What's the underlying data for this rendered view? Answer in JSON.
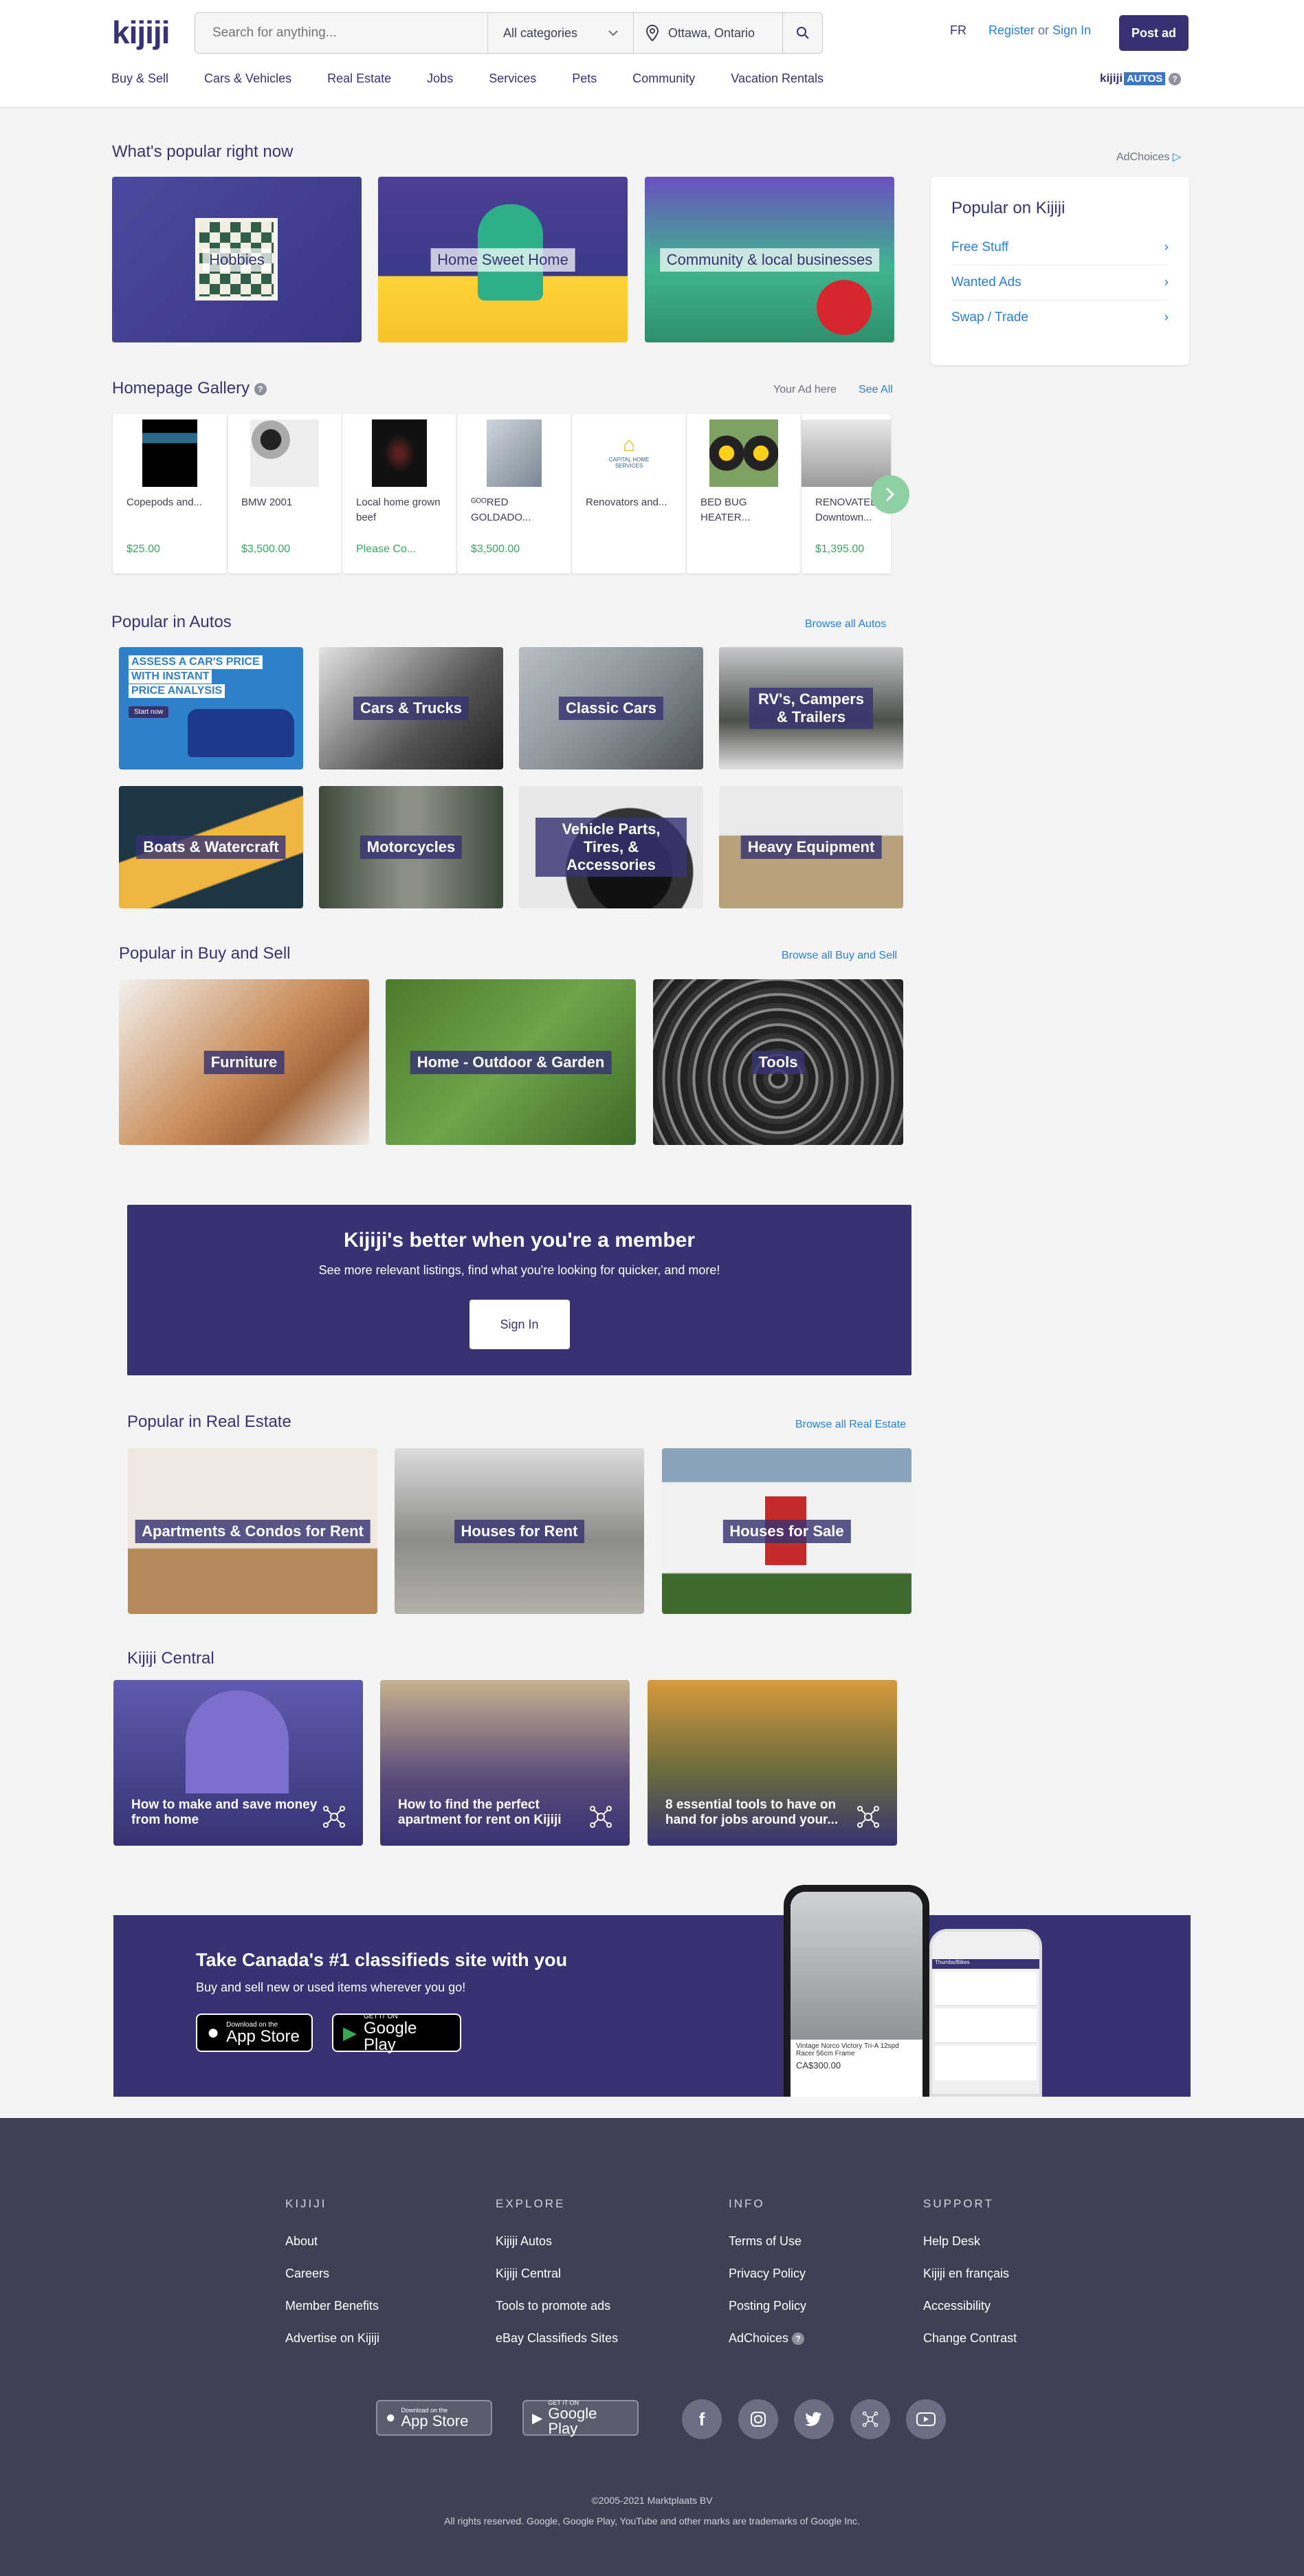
{
  "header": {
    "logo": "kijiji",
    "search_placeholder": "Search for anything...",
    "category": "All categories",
    "location": "Ottawa, Ontario",
    "lang": "FR",
    "register": "Register",
    "or": "or",
    "sign_in": "Sign In",
    "post_ad": "Post ad",
    "autos_logo_a": "kijiji",
    "autos_logo_b": "AUTOS"
  },
  "nav": [
    "Buy & Sell",
    "Cars & Vehicles",
    "Real Estate",
    "Jobs",
    "Services",
    "Pets",
    "Community",
    "Vacation Rentals"
  ],
  "popular_now": {
    "title": "What's popular right now",
    "tiles": [
      "Hobbies",
      "Home Sweet Home",
      "Community & local businesses"
    ]
  },
  "adchoices": "AdChoices",
  "popular_kijiji": {
    "title": "Popular on Kijiji",
    "items": [
      "Free Stuff",
      "Wanted Ads",
      "Swap / Trade"
    ]
  },
  "gallery": {
    "title": "Homepage Gallery",
    "your_ad": "Your Ad here",
    "see_all": "See All",
    "items": [
      {
        "title": "Copepods and...",
        "price": "$25.00"
      },
      {
        "title": "BMW 2001",
        "price": "$3,500.00"
      },
      {
        "title": "Local home grown beef",
        "price": "Please Co..."
      },
      {
        "title": "ᴳᴼᴼRED GOLDADO...",
        "price": "$3,500.00"
      },
      {
        "title": "Renovators and...",
        "price": ""
      },
      {
        "title": "BED BUG HEATER...",
        "price": ""
      },
      {
        "title": "RENOVATED Downtown...",
        "price": "$1,395.00"
      }
    ],
    "capital_text": "CAPITAL HOME SERVICES"
  },
  "autos": {
    "title": "Popular in Autos",
    "browse": "Browse all Autos",
    "promo_line1": "ASSESS A CAR'S PRICE",
    "promo_line2": "WITH INSTANT",
    "promo_line3": "PRICE ANALYSIS",
    "promo_btn": "Start now",
    "tiles": [
      "Cars & Trucks",
      "Classic Cars",
      "RV's, Campers & Trailers",
      "Boats & Watercraft",
      "Motorcycles",
      "Vehicle Parts, Tires, & Accessories",
      "Heavy Equipment"
    ]
  },
  "buysell": {
    "title": "Popular in Buy and Sell",
    "browse": "Browse all Buy and Sell",
    "tiles": [
      "Furniture",
      "Home - Outdoor & Garden",
      "Tools"
    ]
  },
  "member": {
    "title": "Kijiji's better when you're a member",
    "subtitle": "See more relevant listings, find what you're looking for quicker, and more!",
    "button": "Sign In"
  },
  "realestate": {
    "title": "Popular in Real Estate",
    "browse": "Browse all Real Estate",
    "tiles": [
      "Apartments & Condos for Rent",
      "Houses for Rent",
      "Houses for Sale"
    ]
  },
  "central": {
    "title": "Kijiji Central",
    "cards": [
      "How to make and save money from home",
      "How to find the perfect apartment for rent on Kijiji",
      "8 essential tools to have on hand for jobs around your..."
    ]
  },
  "app_banner": {
    "title": "Take Canada's #1 classifieds site with you",
    "subtitle": "Buy and sell new or used items wherever you go!",
    "appstore_small": "Download on the",
    "appstore_big": "App Store",
    "googleplay_small": "GET IT ON",
    "googleplay_big": "Google Play",
    "phone_title": "Vintage Norco Victory Tri-A 12spd Racer 56cm Frame",
    "phone_price": "CA$300.00",
    "phone2_header": "Thumbs/Bikes"
  },
  "footer": {
    "cols": [
      {
        "title": "KIJIJI",
        "links": [
          "About",
          "Careers",
          "Member Benefits",
          "Advertise on Kijiji"
        ]
      },
      {
        "title": "EXPLORE",
        "links": [
          "Kijiji Autos",
          "Kijiji Central",
          "Tools to promote ads",
          "eBay Classifieds Sites"
        ]
      },
      {
        "title": "INFO",
        "links": [
          "Terms of Use",
          "Privacy Policy",
          "Posting Policy",
          "AdChoices"
        ]
      },
      {
        "title": "SUPPORT",
        "links": [
          "Help Desk",
          "Kijiji en français",
          "Accessibility",
          "Change Contrast"
        ]
      }
    ],
    "copyright": "©2005-2021 Marktplaats BV",
    "trademarks": "All rights reserved. Google, Google Play, YouTube and other marks are trademarks of Google Inc."
  },
  "colors": {
    "brand": "#373373",
    "link": "#2681db",
    "price": "#37a864",
    "footer": "#3e4153"
  }
}
